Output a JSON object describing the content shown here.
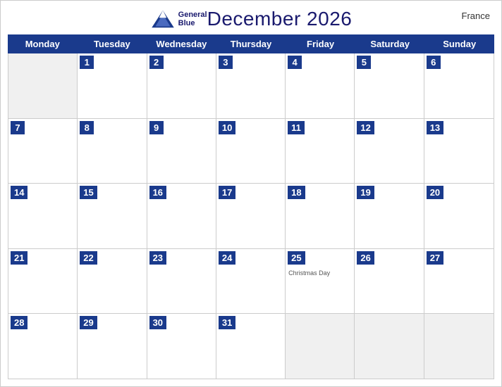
{
  "header": {
    "title": "December 2026",
    "country": "France",
    "logo_general": "General",
    "logo_blue": "Blue"
  },
  "calendar": {
    "days_of_week": [
      "Monday",
      "Tuesday",
      "Wednesday",
      "Thursday",
      "Friday",
      "Saturday",
      "Sunday"
    ],
    "weeks": [
      [
        {
          "date": "",
          "empty": true
        },
        {
          "date": "1"
        },
        {
          "date": "2"
        },
        {
          "date": "3"
        },
        {
          "date": "4"
        },
        {
          "date": "5"
        },
        {
          "date": "6"
        }
      ],
      [
        {
          "date": "7"
        },
        {
          "date": "8"
        },
        {
          "date": "9"
        },
        {
          "date": "10"
        },
        {
          "date": "11"
        },
        {
          "date": "12"
        },
        {
          "date": "13"
        }
      ],
      [
        {
          "date": "14"
        },
        {
          "date": "15"
        },
        {
          "date": "16"
        },
        {
          "date": "17"
        },
        {
          "date": "18"
        },
        {
          "date": "19"
        },
        {
          "date": "20"
        }
      ],
      [
        {
          "date": "21"
        },
        {
          "date": "22"
        },
        {
          "date": "23"
        },
        {
          "date": "24"
        },
        {
          "date": "25",
          "holiday": "Christmas Day"
        },
        {
          "date": "26"
        },
        {
          "date": "27"
        }
      ],
      [
        {
          "date": "28"
        },
        {
          "date": "29"
        },
        {
          "date": "30"
        },
        {
          "date": "31"
        },
        {
          "date": "",
          "empty": true
        },
        {
          "date": "",
          "empty": true
        },
        {
          "date": "",
          "empty": true
        }
      ]
    ]
  }
}
